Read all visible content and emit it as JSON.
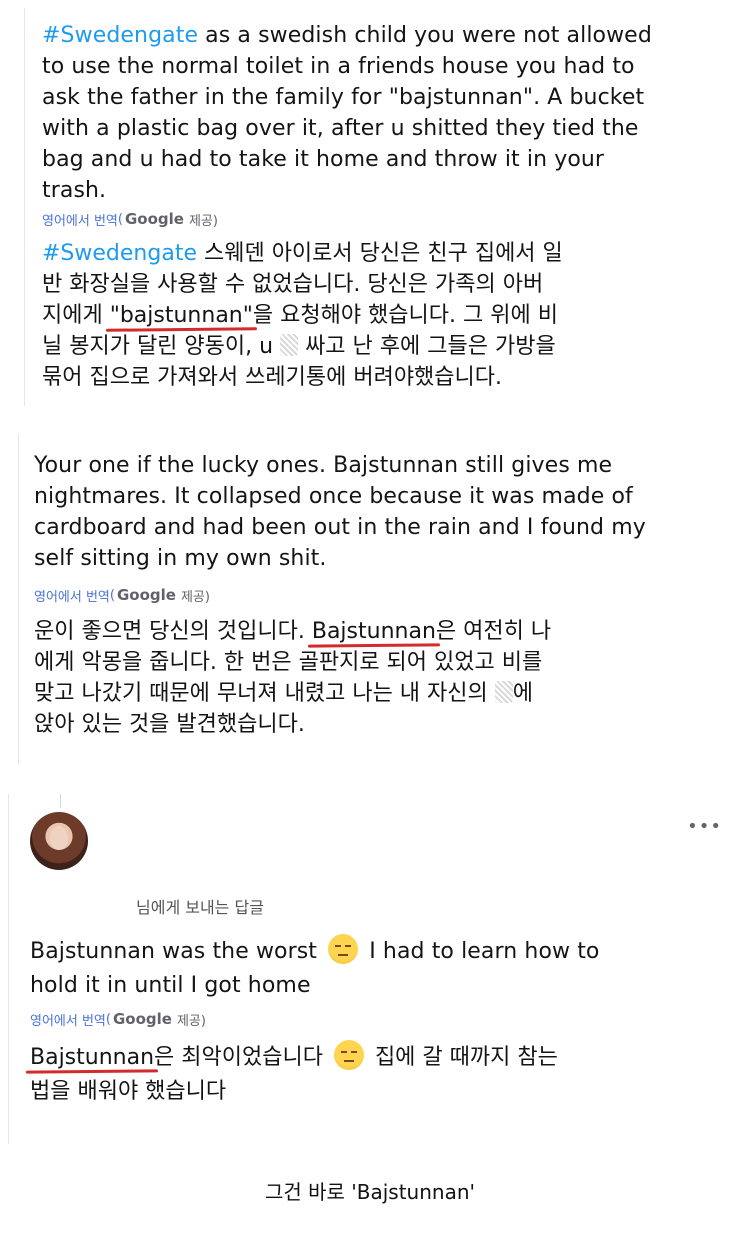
{
  "tweet1": {
    "hashtag": "#Swedengate",
    "text_lines": [
      " as a swedish child you were not allowed",
      "to use the normal toilet in a friends house you had to",
      "ask the father in the family for \"bajstunnan\". A bucket",
      "with a plastic bag over it, after u shitted they tied the",
      "bag and u had to take it home and throw it in your",
      "trash."
    ],
    "translate": {
      "prefix": "영어에서 번역",
      "open": "(",
      "google": "Google",
      "suffix": "제공)"
    },
    "kor_hashtag": "#Swedengate",
    "kor_line1_rest": " 스웨덴 아이로서 당신은 친구 집에서 일",
    "kor_line2": "반 화장실을 사용할 수 없었습니다. 당신은 가족의 아버",
    "kor_line3_pre": "지에게 ",
    "kor_line3_ul": "\"bajstunnan\"",
    "kor_line3_post": "을 요청해야 했습니다. 그 위에 비",
    "kor_line4_pre": "닐 봉지가 달린 양동이, u ",
    "kor_line4_post": " 싸고 난 후에 그들은 가방을",
    "kor_line5": "묶어 집으로 가져와서 쓰레기통에 버려야했습니다."
  },
  "tweet2": {
    "text_lines": [
      "Your one if the lucky ones. Bajstunnan still gives me",
      "nightmares. It collapsed once because it was made of",
      "cardboard and had been out in the rain and I found my",
      "self sitting in my own shit."
    ],
    "translate": {
      "prefix": "영어에서 번역",
      "open": "(",
      "google": "Google",
      "suffix": "제공)"
    },
    "kor_line1_pre": "운이 좋으면 당신의 것입니다. ",
    "kor_line1_ul": "Bajstunnan",
    "kor_line1_post": "은 여전히 나",
    "kor_line2": "에게 악몽을 줍니다. 한 번은 골판지로 되어 있었고 비를",
    "kor_line3_pre": "맞고 나갔기 때문에 무너져 내렸고 나는 내 자신의 ",
    "kor_line3_post": "에",
    "kor_line4": "앉아 있는 것을 발견했습니다."
  },
  "tweet3": {
    "more": "•••",
    "reply_to": "님에게 보내는 답글",
    "line1_pre": "Bajstunnan was the worst ",
    "line1_post": " I had to learn how to",
    "line2": "hold it in until I got home",
    "translate": {
      "prefix": "영어에서 번역",
      "open": "(",
      "google": "Google",
      "suffix": "제공)"
    },
    "kor_line1_ul": "Bajstunnan",
    "kor_line1_mid": "은 최악이었습니다 ",
    "kor_line1_post": " 집에 갈 때까지 참는",
    "kor_line2": "법을 배워야 했습니다"
  },
  "caption": "그건 바로 'Bajstunnan'"
}
